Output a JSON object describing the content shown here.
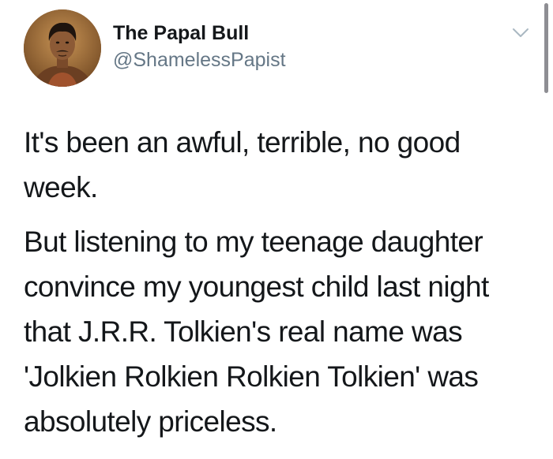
{
  "tweet": {
    "author": {
      "display_name": "The Papal Bull",
      "handle": "@ShamelessPapist"
    },
    "paragraphs": [
      "It's been an awful, terrible, no good week.",
      "But listening to my teenage daughter convince my youngest child last night that J.R.R. Tolkien's real name was 'Jolkien Rolkien Rolkien Tolkien' was absolutely priceless."
    ],
    "menu_icon": "chevron-down-icon"
  },
  "colors": {
    "text": "#14171a",
    "secondary_text": "#657786",
    "chevron": "#aab8c2",
    "background": "#ffffff"
  }
}
